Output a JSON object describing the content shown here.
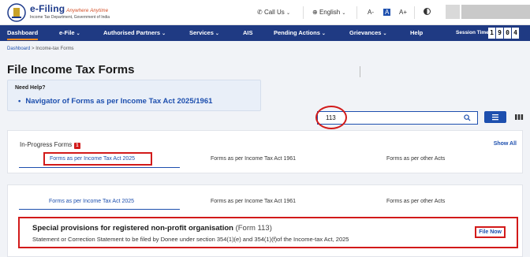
{
  "header": {
    "brand_title": "e-Filing",
    "brand_tagline": "Anywhere Anytime",
    "brand_subtitle": "Income Tax Department, Government of India",
    "call_us": "Call Us",
    "language": "English",
    "font_small": "A-",
    "font_normal": "A",
    "font_large": "A+"
  },
  "nav": {
    "items": [
      {
        "label": "Dashboard"
      },
      {
        "label": "e-File"
      },
      {
        "label": "Authorised Partners"
      },
      {
        "label": "Services"
      },
      {
        "label": "AIS"
      },
      {
        "label": "Pending Actions"
      },
      {
        "label": "Grievances"
      },
      {
        "label": "Help"
      }
    ],
    "session_label": "Session Time",
    "session_digits": [
      "1",
      "9",
      "0",
      "4"
    ]
  },
  "breadcrumb": {
    "home": "Dashboard",
    "separator": ">",
    "current": "Income-tax Forms"
  },
  "page": {
    "title": "File Income Tax Forms"
  },
  "help": {
    "title": "Need Help?",
    "link": "Navigator of Forms as per Income Tax Act 2025/1961"
  },
  "search": {
    "value": "113"
  },
  "in_progress": {
    "title": "In-Progress Forms",
    "count": "1",
    "show_all": "Show All",
    "tabs": [
      {
        "label": "Forms as per Income Tax Act 2025"
      },
      {
        "label": "Forms as per Income Tax Act 1961"
      },
      {
        "label": "Forms as per other Acts"
      }
    ]
  },
  "all_forms": {
    "tabs": [
      {
        "label": "Forms as per Income Tax Act 2025"
      },
      {
        "label": "Forms as per Income Tax Act 1961"
      },
      {
        "label": "Forms as per other Acts"
      }
    ],
    "result": {
      "title": "Special provisions for registered non-profit organisation",
      "code": "(Form 113)",
      "description": "Statement or Correction Statement to be filed by Donee under section 354(1)(e) and 354(1)(f)of the Income-tax Act, 2025",
      "action": "File Now"
    }
  },
  "colors": {
    "nav_bg": "#1f3a83",
    "link": "#1d4fae",
    "highlight": "#d21a1a",
    "accent": "#f58a1f"
  }
}
